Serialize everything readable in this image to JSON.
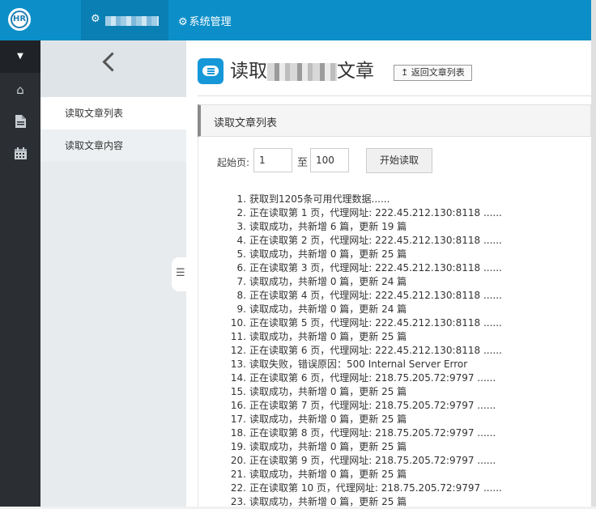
{
  "header": {
    "logo_text": "HR",
    "nav_items": [
      {
        "label": "",
        "icon": "cogs-icon"
      },
      {
        "label": "系统管理",
        "icon": "cogs-icon"
      }
    ]
  },
  "rail": {
    "icons": [
      "caret-down-icon",
      "home-icon",
      "file-icon",
      "calendar-icon"
    ]
  },
  "sidebar": {
    "back_icon": "chevron-left-icon",
    "items": [
      {
        "label": "读取文章列表",
        "active": true
      },
      {
        "label": "读取文章内容",
        "active": false
      }
    ]
  },
  "main": {
    "title_prefix": "读取",
    "title_suffix": "文章",
    "back_button": "返回文章列表",
    "panel_title": "读取文章列表",
    "form": {
      "start_label": "起始页:",
      "start_value": "1",
      "to_label": "至",
      "end_value": "100",
      "submit_label": "开始读取"
    },
    "log": [
      "获取到1205条可用代理数据......",
      "正在读取第 1 页，代理网址: 222.45.212.130:8118 ......",
      "读取成功，共新增 6 篇，更新 19 篇",
      "正在读取第 2 页，代理网址: 222.45.212.130:8118 ......",
      "读取成功，共新增 0 篇，更新 25 篇",
      "正在读取第 3 页，代理网址: 222.45.212.130:8118 ......",
      "读取成功，共新增 0 篇，更新 24 篇",
      "正在读取第 4 页，代理网址: 222.45.212.130:8118 ......",
      "读取成功，共新增 0 篇，更新 24 篇",
      "正在读取第 5 页，代理网址: 222.45.212.130:8118 ......",
      "读取成功，共新增 0 篇，更新 25 篇",
      "正在读取第 6 页，代理网址: 222.45.212.130:8118 ......",
      "读取失败，错误原因：500 Internal Server Error",
      "正在读取第 6 页，代理网址: 218.75.205.72:9797 ......",
      "读取成功，共新增 0 篇，更新 25 篇",
      "正在读取第 7 页，代理网址: 218.75.205.72:9797 ......",
      "读取成功，共新增 0 篇，更新 25 篇",
      "正在读取第 8 页，代理网址: 218.75.205.72:9797 ......",
      "读取成功，共新增 0 篇，更新 25 篇",
      "正在读取第 9 页，代理网址: 218.75.205.72:9797 ......",
      "读取成功，共新增 0 篇，更新 25 篇",
      "正在读取第 10 页，代理网址: 218.75.205.72:9797 ......",
      "读取成功，共新增 0 篇，更新 25 篇"
    ]
  },
  "colors": {
    "header_bg": "#0c8fc8",
    "rail_bg": "#2b2f34",
    "accent": "#1597d8"
  }
}
